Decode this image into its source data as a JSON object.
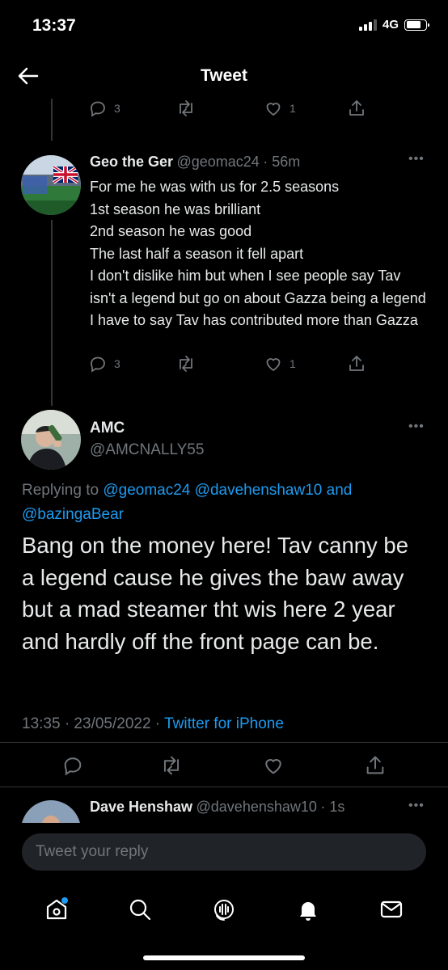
{
  "status": {
    "time": "13:37",
    "network": "4G"
  },
  "header": {
    "title": "Tweet"
  },
  "top_actions": {
    "reply_count": "3",
    "like_count": "1"
  },
  "tweet1": {
    "name": "Geo the Ger",
    "handle": "@geomac24",
    "time": "· 56m",
    "text": "For me he was with us for 2.5 seasons\n1st season he was brilliant\n2nd season he was good\nThe last half a season it fell apart\nI don't dislike him but when I see people say Tav isn't a legend but go on about Gazza being a legend I have to say Tav has contributed more than Gazza",
    "reply_count": "3",
    "like_count": "1"
  },
  "main_tweet": {
    "name": "AMC",
    "handle": "@AMCNALLY55",
    "replying_prefix": "Replying to ",
    "replying_user1": "@geomac24",
    "replying_user2": "@davehenshaw10",
    "replying_and": " and",
    "replying_user3": "@bazingaBear",
    "text": "Bang on the money here! Tav canny be a legend cause he gives the baw away but a mad steamer tht wis here 2 year and hardly off the front page can be.",
    "timestamp": "13:35 · 23/05/2022 · ",
    "source": "Twitter for iPhone"
  },
  "next_reply": {
    "name": "Dave Henshaw",
    "handle": "@davehenshaw10",
    "time": "· 1s"
  },
  "composer": {
    "placeholder": "Tweet your reply"
  },
  "colors": {
    "accent": "#1d9bf0",
    "muted": "#71767b",
    "background": "#000000"
  }
}
